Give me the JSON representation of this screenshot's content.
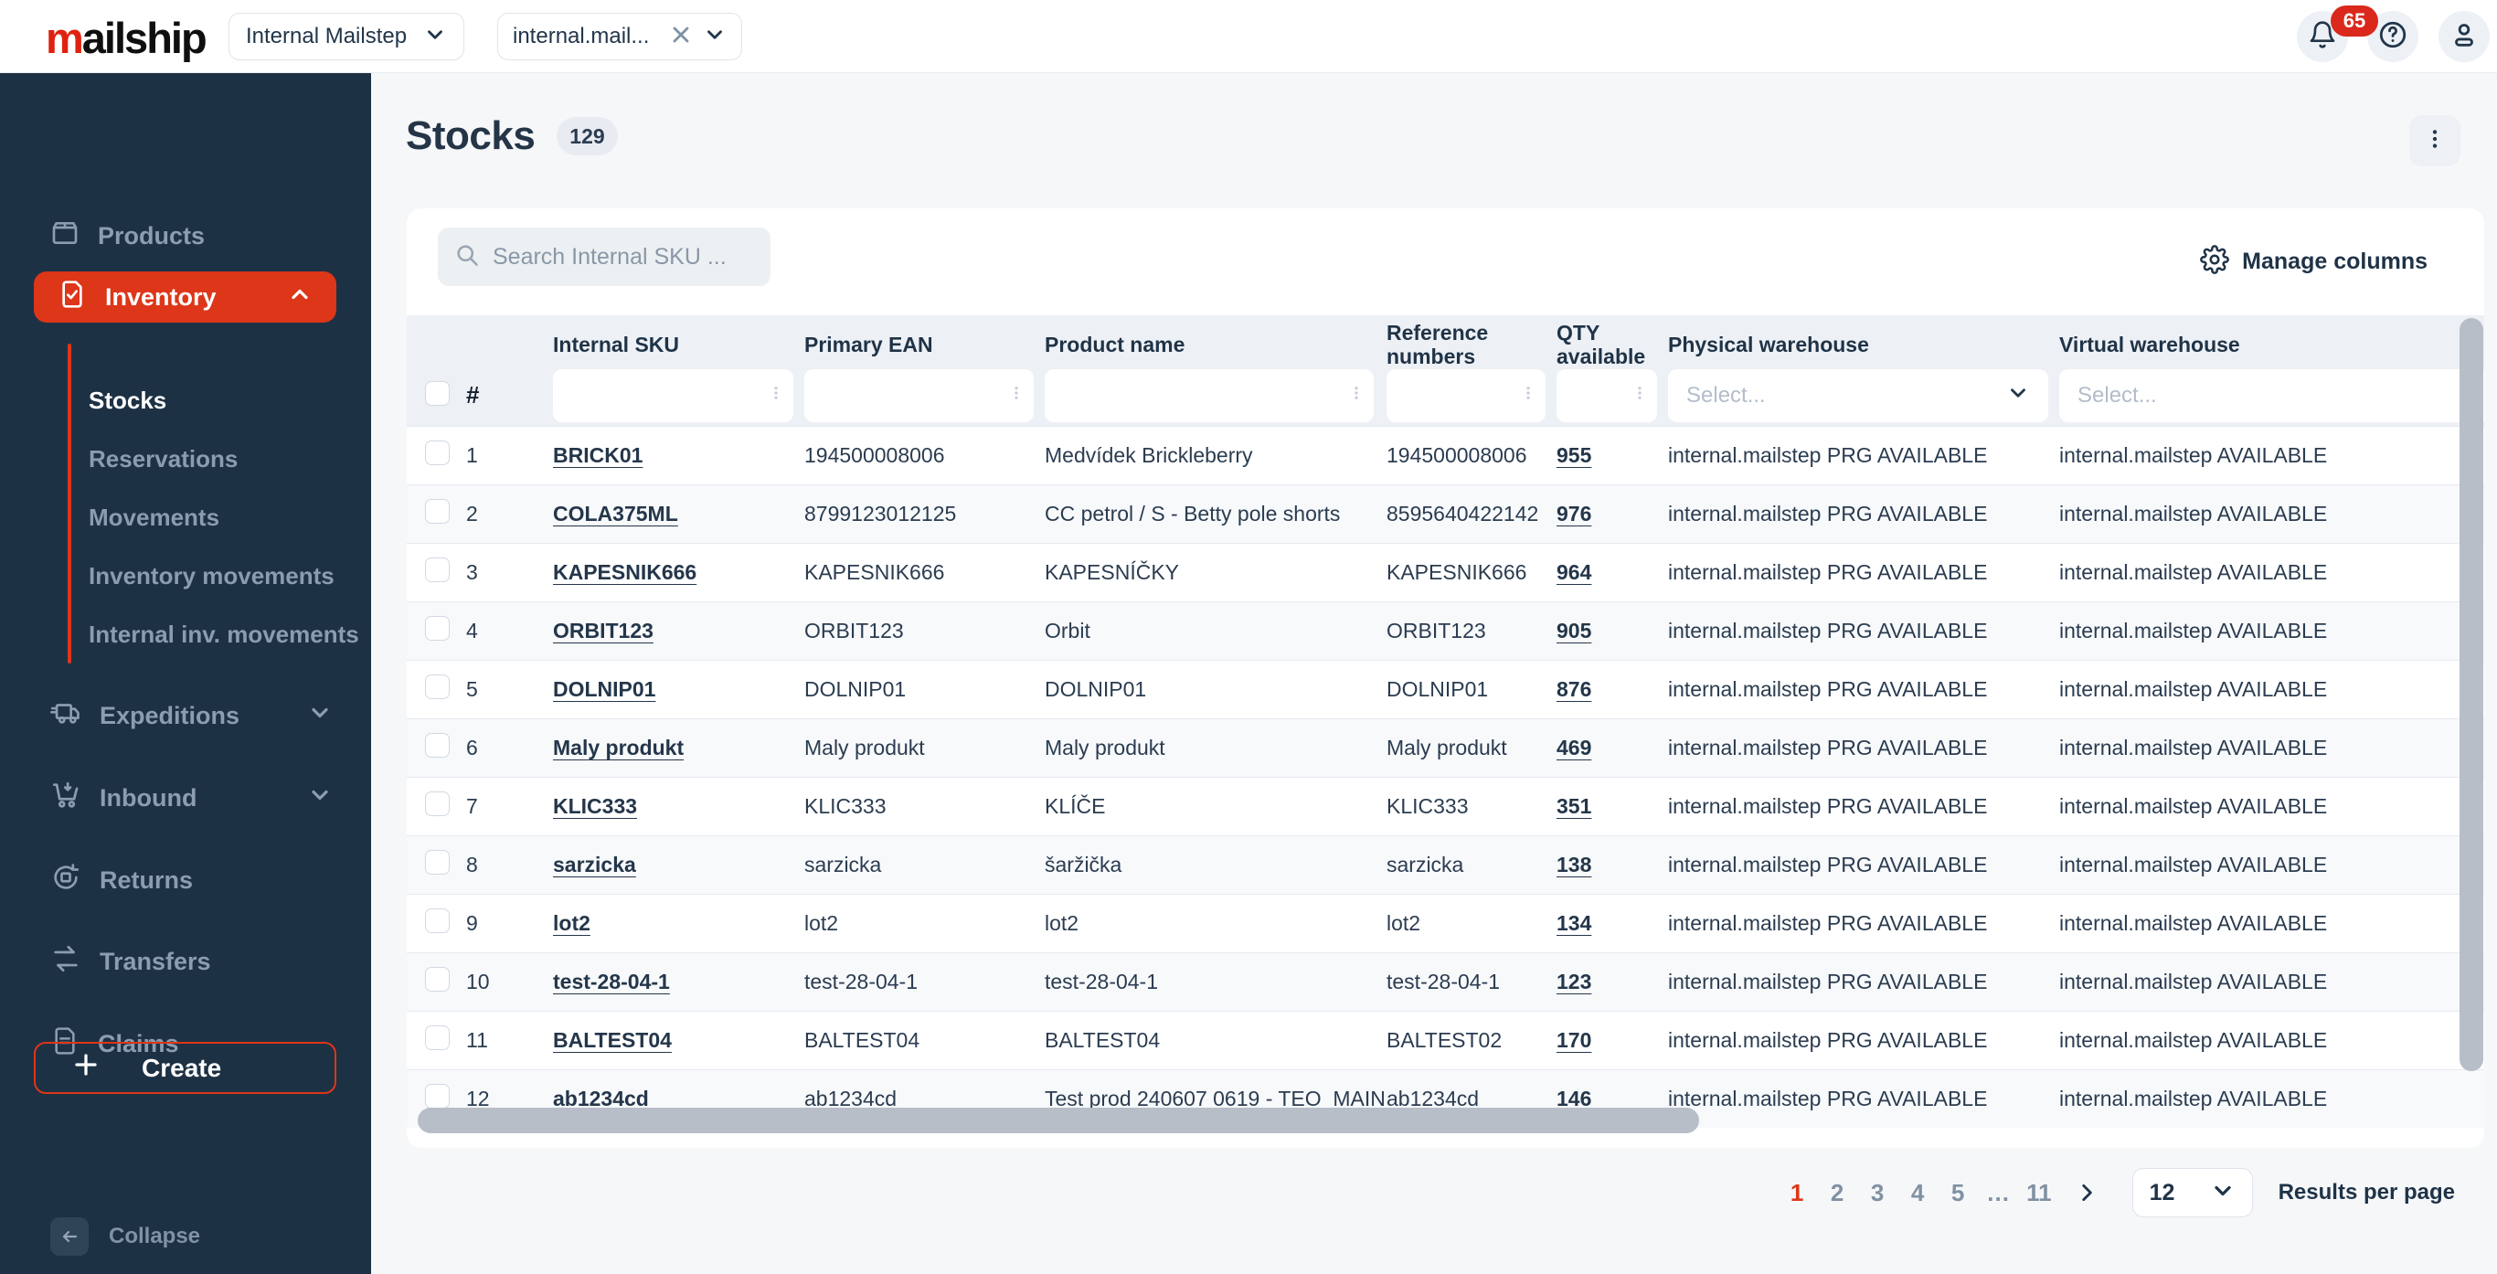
{
  "colors": {
    "accent": "#dd3619",
    "sidebar_bg": "#1d3144",
    "badge_red": "#da291c"
  },
  "topbar": {
    "logo_m": "m",
    "logo_rest": "ailship",
    "workspace_select": {
      "value": "Internal Mailstep"
    },
    "org_chip": {
      "value": "internal.mail..."
    },
    "notifications_count": "65"
  },
  "sidebar": {
    "items": [
      {
        "label": "Products"
      },
      {
        "label": "Inventory"
      },
      {
        "label": "Expeditions"
      },
      {
        "label": "Inbound"
      },
      {
        "label": "Returns"
      },
      {
        "label": "Transfers"
      },
      {
        "label": "Claims"
      }
    ],
    "inventory_submenu": [
      {
        "label": "Stocks",
        "active": true
      },
      {
        "label": "Reservations",
        "active": false
      },
      {
        "label": "Movements",
        "active": false
      },
      {
        "label": "Inventory movements",
        "active": false
      },
      {
        "label": "Internal inv. movements",
        "active": false
      }
    ],
    "create_label": "Create",
    "collapse_label": "Collapse"
  },
  "page": {
    "title": "Stocks",
    "count_badge": "129"
  },
  "toolbar": {
    "search_placeholder": "Search Internal SKU ...",
    "manage_columns_label": "Manage columns"
  },
  "table": {
    "columns": {
      "num": "#",
      "sku": "Internal SKU",
      "ean": "Primary EAN",
      "name": "Product name",
      "ref": "Reference numbers",
      "qty": "QTY available",
      "phys": "Physical warehouse",
      "virt": "Virtual warehouse"
    },
    "filters": {
      "select_placeholder": "Select..."
    },
    "rows": [
      {
        "num": "1",
        "sku": "BRICK01",
        "ean": "194500008006",
        "name": "Medvídek Brickleberry",
        "ref": "194500008006",
        "qty": "955",
        "phys": "internal.mailstep PRG AVAILABLE",
        "virt": "internal.mailstep AVAILABLE"
      },
      {
        "num": "2",
        "sku": "COLA375ML",
        "ean": "8799123012125",
        "name": "CC petrol / S - Betty pole shorts",
        "ref": "8595640422142",
        "qty": "976",
        "phys": "internal.mailstep PRG AVAILABLE",
        "virt": "internal.mailstep AVAILABLE"
      },
      {
        "num": "3",
        "sku": "KAPESNIK666",
        "ean": "KAPESNIK666",
        "name": "KAPESNÍČKY",
        "ref": "KAPESNIK666",
        "qty": "964",
        "phys": "internal.mailstep PRG AVAILABLE",
        "virt": "internal.mailstep AVAILABLE"
      },
      {
        "num": "4",
        "sku": "ORBIT123",
        "ean": "ORBIT123",
        "name": "Orbit",
        "ref": "ORBIT123",
        "qty": "905",
        "phys": "internal.mailstep PRG AVAILABLE",
        "virt": "internal.mailstep AVAILABLE"
      },
      {
        "num": "5",
        "sku": "DOLNIP01",
        "ean": "DOLNIP01",
        "name": "DOLNIP01",
        "ref": "DOLNIP01",
        "qty": "876",
        "phys": "internal.mailstep PRG AVAILABLE",
        "virt": "internal.mailstep AVAILABLE"
      },
      {
        "num": "6",
        "sku": "Maly produkt",
        "ean": "Maly produkt",
        "name": "Maly produkt",
        "ref": "Maly produkt",
        "qty": "469",
        "phys": "internal.mailstep PRG AVAILABLE",
        "virt": "internal.mailstep AVAILABLE"
      },
      {
        "num": "7",
        "sku": "KLIC333",
        "ean": "KLIC333",
        "name": "KLÍČE",
        "ref": "KLIC333",
        "qty": "351",
        "phys": "internal.mailstep PRG AVAILABLE",
        "virt": "internal.mailstep AVAILABLE"
      },
      {
        "num": "8",
        "sku": "sarzicka",
        "ean": "sarzicka",
        "name": "šaržička",
        "ref": "sarzicka",
        "qty": "138",
        "phys": "internal.mailstep PRG AVAILABLE",
        "virt": "internal.mailstep AVAILABLE"
      },
      {
        "num": "9",
        "sku": "lot2",
        "ean": "lot2",
        "name": "lot2",
        "ref": "lot2",
        "qty": "134",
        "phys": "internal.mailstep PRG AVAILABLE",
        "virt": "internal.mailstep AVAILABLE"
      },
      {
        "num": "10",
        "sku": "test-28-04-1",
        "ean": "test-28-04-1",
        "name": "test-28-04-1",
        "ref": "test-28-04-1",
        "qty": "123",
        "phys": "internal.mailstep PRG AVAILABLE",
        "virt": "internal.mailstep AVAILABLE"
      },
      {
        "num": "11",
        "sku": "BALTEST04",
        "ean": "BALTEST04",
        "name": "BALTEST04",
        "ref": "BALTEST02",
        "qty": "170",
        "phys": "internal.mailstep PRG AVAILABLE",
        "virt": "internal.mailstep AVAILABLE"
      },
      {
        "num": "12",
        "sku": "ab1234cd",
        "ean": "ab1234cd",
        "name": "Test prod 240607 0619 - TEO_MAIN",
        "ref": "ab1234cd",
        "qty": "146",
        "phys": "internal.mailstep PRG AVAILABLE",
        "virt": "internal.mailstep AVAILABLE"
      }
    ]
  },
  "pagination": {
    "pages": [
      "1",
      "2",
      "3",
      "4",
      "5",
      "…",
      "11"
    ],
    "active": "1",
    "per_page": "12",
    "results_label": "Results per page"
  }
}
